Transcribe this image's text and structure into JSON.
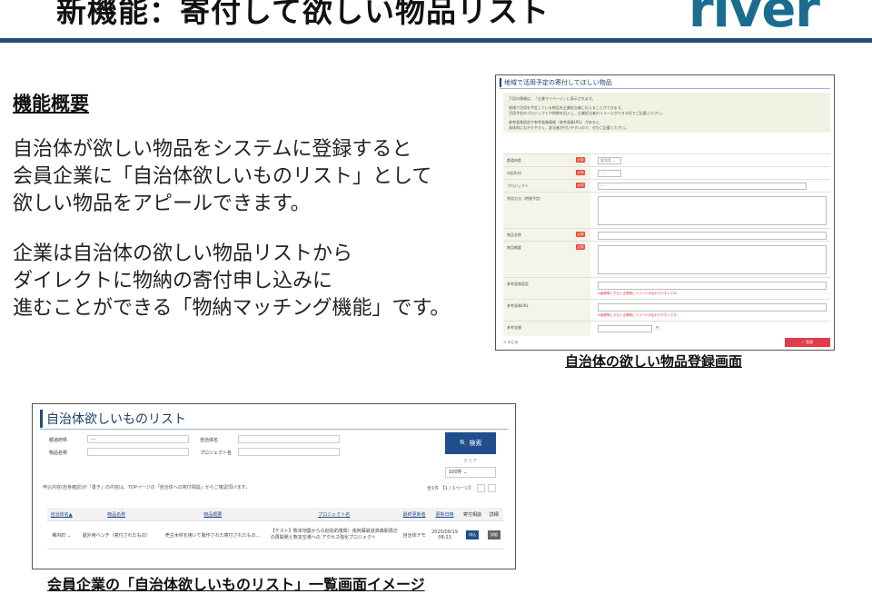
{
  "header": {
    "title": "新機能：寄付して欲しい物品リスト",
    "logo": "river",
    "brand_color": "#1f4e79"
  },
  "overview": {
    "heading": "機能概要",
    "paragraph1": [
      "自治体が欲しい物品をシステムに登録すると",
      "会員企業に「自治体欲しいものリスト」として",
      "欲しい物品をアピールできます。"
    ],
    "paragraph2": [
      "企業は自治体の欲しい物品リストから",
      "ダイレクトに物納の寄付申し込みに",
      "進むことができる「物納マッチング機能」です。"
    ]
  },
  "registration_screen": {
    "title": "地域で活用予定の寄付してほしい物品",
    "notes": [
      "下記の情報は、「企業マイページ」に表示されます。",
      "地域で活用を予定している物品を企業担当者に伝えることができます。",
      "活用予定のプロジェクトや時期を記入し、企業担当者のイメージができる形でご記載ください。",
      "参考画像設定や参考画像情報（参考画像URL）があると、",
      "具体的にわかりやすく、該当者が付いやすいので、ぜひご記載ください。"
    ],
    "fields": [
      {
        "label": "都道府県",
        "required": true,
        "value": "愛知県 ⌄"
      },
      {
        "label": "市区町村",
        "required": true,
        "value": "- ⌄"
      },
      {
        "label": "プロジェクト",
        "required": true,
        "value": "---"
      },
      {
        "label": "利用方法（時間予定）",
        "required": false,
        "value": ""
      },
      {
        "label": "物品名称",
        "required": true,
        "value": ""
      },
      {
        "label": "物品概要",
        "required": true,
        "value": ""
      },
      {
        "label": "参考画像設定",
        "required": false,
        "value": "",
        "hint": "※画像等にすると企業側にイメージが伝わりやすいです。"
      },
      {
        "label": "参考画像URL",
        "required": false,
        "value": "",
        "hint": "※画像等にすると企業側にイメージが伝わりやすいです。"
      },
      {
        "label": "参考金額",
        "required": false,
        "value": "",
        "suffix": "円"
      }
    ],
    "required_badge": "必須",
    "back_link": "< もどる",
    "submit_label": "✓ 登録",
    "caption": "自治体の欲しい物品登録画面"
  },
  "list_screen": {
    "title": "自治体欲しいものリスト",
    "filters": {
      "prefecture_label": "都道府県",
      "prefecture_value": "---",
      "municipality_label": "自治体名",
      "item_label": "物品名称",
      "project_label": "プロジェクト名"
    },
    "search_label": "🔍 検索",
    "clear_label": "クリア",
    "per_page": "100件 ⌄",
    "note": "申込内容(自身確認)が「書き」の内容は、TOPページの「自治体への寄付相談」からご確認頂けます。",
    "pager": "全1件 【1 / 1ページ】",
    "columns": [
      "自治体名▲",
      "物品名称",
      "物品概要",
      "プロジェクト名",
      "最終更新者",
      "更新日時",
      "寄付相談",
      "詳細"
    ],
    "rows": [
      {
        "municipality": "稚内町 ⌄",
        "item": "屋外用ベンチ（寄付されたもの）",
        "summary": "売主木材を用いて製作された寄付されたもの…",
        "project": "【テスト】熊本地震からの創造的復興！南阿蘇鉄道高森駅周辺の再開発と熊本空港への アクセス強化プロジェクト",
        "updater": "自治体デモ",
        "updated": "2025/09/19 08:23",
        "apply": "申込",
        "detail": "詳細"
      }
    ],
    "caption": "会員企業の「自治体欲しいものリスト」一覧画面イメージ"
  }
}
